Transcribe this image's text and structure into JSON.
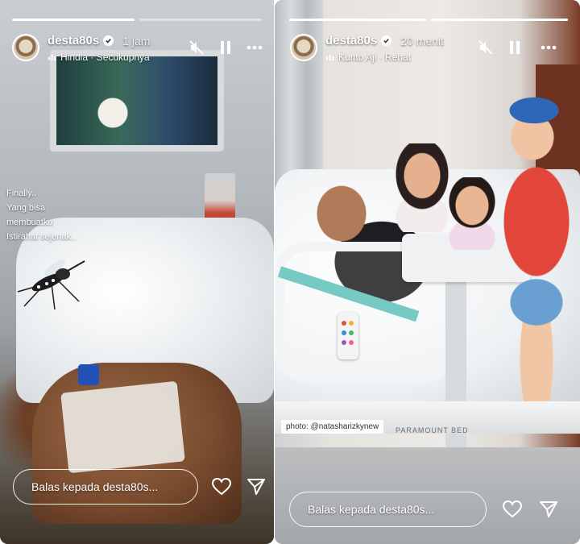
{
  "stories": [
    {
      "username": "desta80s",
      "time": "1 jam",
      "music": "Hindia · Secukupnya",
      "caption_lines": [
        "Finally..",
        "Yang bisa",
        "membuatku",
        "Istirahat sejenak.."
      ],
      "reply_placeholder": "Balas kepada desta80s...",
      "progress": {
        "segments": 2,
        "current": 1,
        "fill": 1.0
      }
    },
    {
      "username": "desta80s",
      "time": "20 menit",
      "music": "Kunto Aji · Rehat",
      "photo_credit": "photo: @natasharizkynew",
      "bed_brand": "PARAMOUNT BED",
      "reply_placeholder": "Balas kepada desta80s...",
      "progress": {
        "segments": 2,
        "current": 2,
        "fill": 1.0
      }
    }
  ],
  "icons": [
    "avatar",
    "verified-badge-icon",
    "music-note-icon",
    "mute-icon",
    "pause-icon",
    "more-icon",
    "heart-icon",
    "send-icon"
  ],
  "colors": {
    "overlay_text": "#ffffff",
    "left_bg": "#2e2f31",
    "right_bg": "#3a3b3d"
  }
}
